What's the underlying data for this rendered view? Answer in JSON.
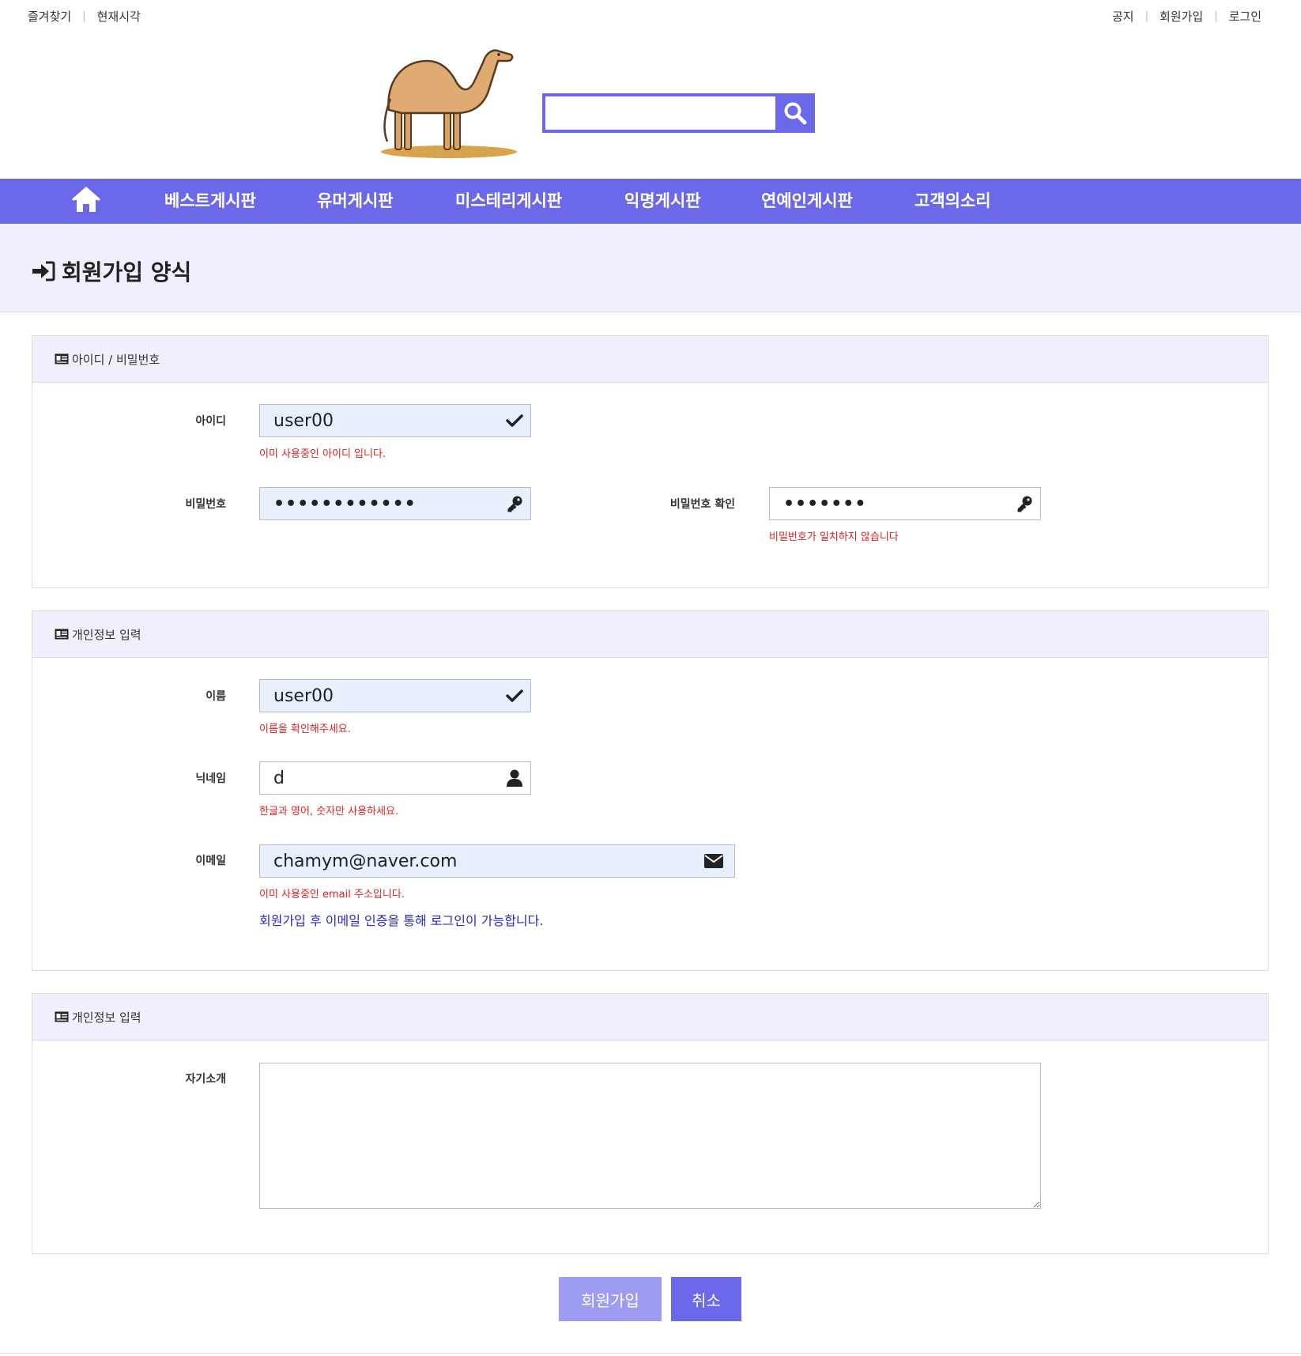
{
  "topbar": {
    "left": [
      "즐겨찾기",
      "현재시각"
    ],
    "right": [
      "공지",
      "회원가입",
      "로그인"
    ]
  },
  "search": {
    "placeholder": "",
    "value": ""
  },
  "nav": {
    "items": [
      "베스트게시판",
      "유머게시판",
      "미스테리게시판",
      "익명게시판",
      "연예인게시판",
      "고객의소리"
    ]
  },
  "page": {
    "title": "회원가입 양식"
  },
  "panel1": {
    "header": "아이디 / 비밀번호",
    "id_label": "아이디",
    "id_value": "user00",
    "id_error": "이미 사용중인 아이디 입니다.",
    "pw_label": "비밀번호",
    "pw_value": "••••••••••••",
    "pw_confirm_label": "비밀번호 확인",
    "pw_confirm_value": "•••••••",
    "pw_confirm_error": "비밀번호가 일치하지 않습니다"
  },
  "panel2": {
    "header": "개인정보 입력",
    "name_label": "이름",
    "name_value": "user00",
    "name_error": "이름을 확인해주세요.",
    "nick_label": "닉네임",
    "nick_value": "d",
    "nick_error": "한글과 영어, 숫자만 사용하세요.",
    "email_label": "이메일",
    "email_value": "chamym@naver.com",
    "email_error": "이미 사용중인 email 주소입니다.",
    "email_info": "회원가입 후 이메일 인증을 통해 로그인이 가능합니다."
  },
  "panel3": {
    "header": "개인정보 입력",
    "intro_label": "자기소개",
    "intro_value": ""
  },
  "buttons": {
    "submit": "회원가입",
    "cancel": "취소"
  },
  "colors": {
    "accent": "#6b68ea",
    "accent_light": "#9e9cf2",
    "band": "#f0f0fc",
    "error": "#e02020",
    "info": "#2727c8",
    "autofill": "#e8f0fe"
  },
  "icons": [
    "camel-logo",
    "search-icon",
    "home-icon",
    "sign-in-icon",
    "id-card-icon",
    "check-icon",
    "key-icon",
    "user-icon",
    "envelope-icon"
  ]
}
